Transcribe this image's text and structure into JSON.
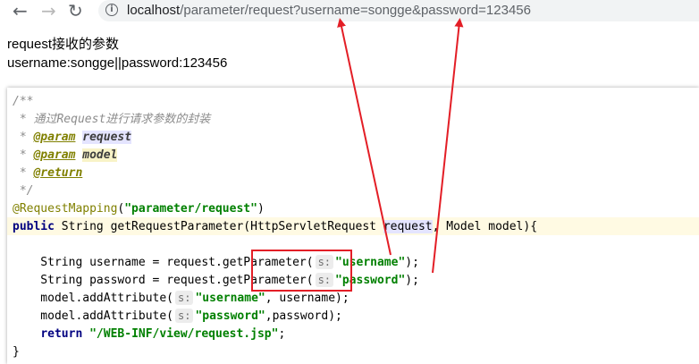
{
  "browser": {
    "back_icon": "←",
    "forward_icon": "→",
    "reload_icon": "↻",
    "info_icon": "i",
    "url_host": "localhost",
    "url_path": "/parameter/request?username=songge&password=123456"
  },
  "response": {
    "line1": "request接收的参数",
    "line2": "username:songge||password:123456"
  },
  "code": {
    "comment_open": "/**",
    "comment_desc": " * 通过Request进行请求参数的封装",
    "star": " * ",
    "param_tag": "@param",
    "param1": "request",
    "param2": "model",
    "return_tag": "@return",
    "comment_close": " */",
    "annotation": "@RequestMapping",
    "mapping_value": "\"parameter/request\"",
    "kw_public": "public",
    "method_sig_a": " String getRequestParameter(HttpServletRequest ",
    "method_param": "request",
    "method_sig_b": ", Model model){",
    "l9_a": "    String username = ",
    "l9_b": "request.",
    "get_param": "getParameter",
    "hint_s": "s:",
    "str_username": "\"username\"",
    "close_stmt": ");",
    "l10_a": "    String password = ",
    "str_password": "\"password\"",
    "l11_a": "    model.addAttribute(",
    "l11_b": ", username);",
    "l12_a": "    model.addAttribute(",
    "l12_b": ",password);",
    "kw_return": "return",
    "str_view": "\"/WEB-INF/view/request.jsp\"",
    "semicolon": ";",
    "brace_close": "}"
  },
  "colors": {
    "annotation_red": "#e31e26"
  }
}
